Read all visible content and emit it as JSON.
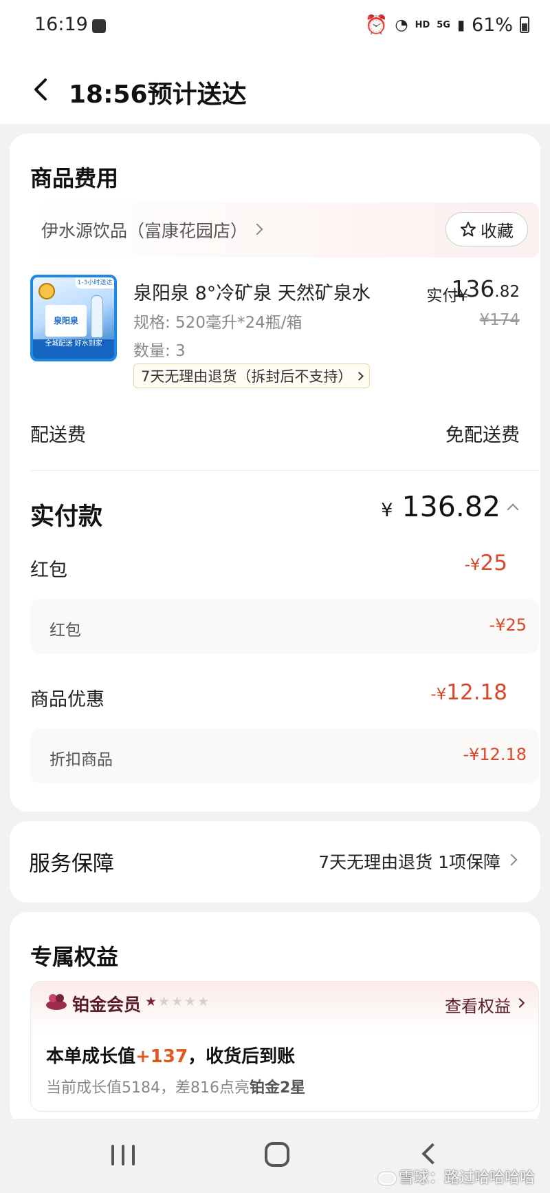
{
  "status_bar": {
    "time": "16:19",
    "net_hd": "HD",
    "net_5g": "5G",
    "battery": "61%"
  },
  "header": {
    "title": "18:56预计送达"
  },
  "goods": {
    "section_title": "商品费用",
    "store_name": "伊水源饮品（富康花园店）",
    "favorite_label": "收藏",
    "product": {
      "name": "泉阳泉 8°冷矿泉 天然矿泉水",
      "spec": "规格: 520毫升*24瓶/箱",
      "quantity": "数量: 3",
      "return_policy": "7天无理由退货（拆封后不支持）",
      "paid_label": "实付",
      "paid_currency": "¥",
      "paid_int": "136",
      "paid_dec": ".82",
      "original_price": "¥174",
      "image_badge": "1-3小时送达",
      "image_brand": "泉阳泉",
      "image_band": "全城配送 好水到家"
    },
    "delivery_label": "配送费",
    "delivery_value": "免配送费",
    "total_label": "实付款",
    "total_currency": "¥",
    "total_value": "136.82",
    "red_packet": {
      "label": "红包",
      "currency": "-¥",
      "value": "25",
      "sub_label": "红包",
      "sub_value": "-¥25"
    },
    "product_discount": {
      "label": "商品优惠",
      "currency": "-¥",
      "value": "12.18",
      "sub_label": "折扣商品",
      "sub_value": "-¥12.18"
    }
  },
  "service": {
    "title": "服务保障",
    "value": "7天无理由退货 1项保障"
  },
  "benefits": {
    "section_title": "专属权益",
    "member_name": "铂金会员",
    "stars_filled": 1,
    "stars_total": 5,
    "view_label": "查看权益",
    "growth_prefix": "本单成长值",
    "growth_value": "+137",
    "growth_suffix": "，收货后到账",
    "current_prefix": "当前成长值5184，差816点亮",
    "current_level": "铂金2星"
  },
  "watermark": "雪球：路过哈哈哈哈",
  "colors": {
    "discount_red": "#d9482b",
    "member_maroon": "#5a1a2c",
    "growth_orange": "#e05a1e"
  }
}
